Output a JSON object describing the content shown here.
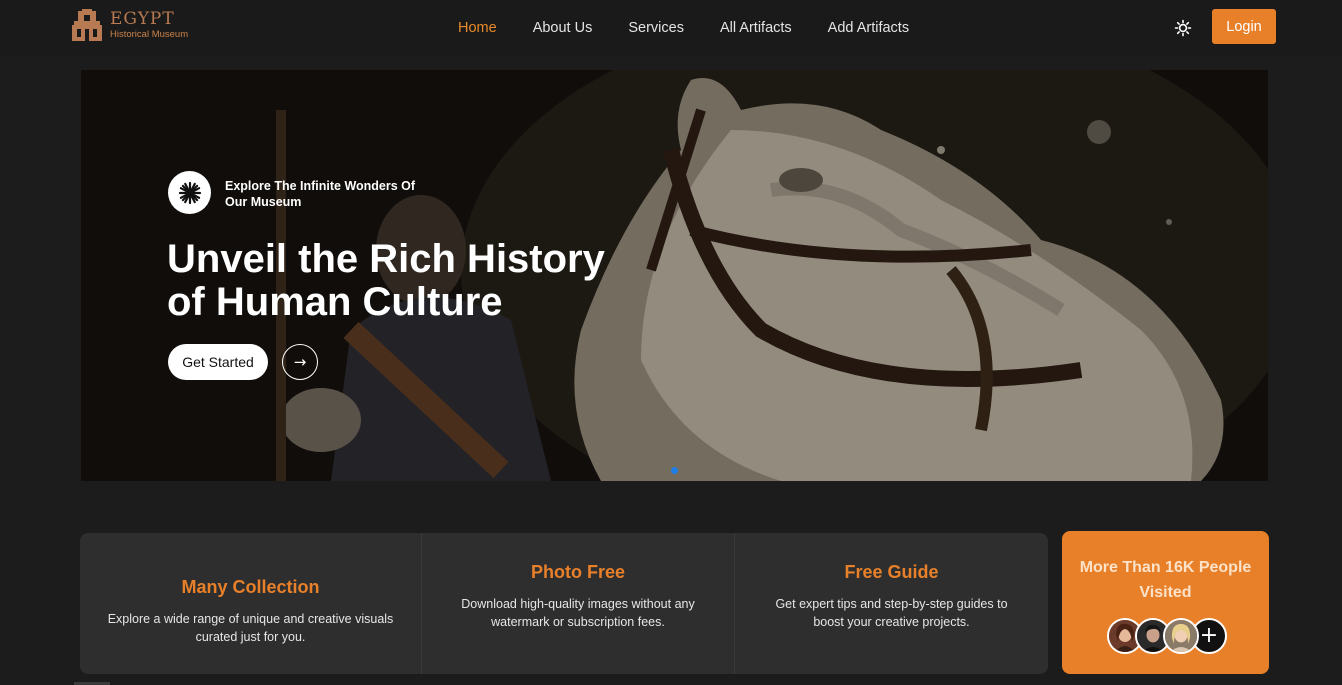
{
  "brand": {
    "title": "EGYPT",
    "subtitle": "Historical Museum"
  },
  "nav": {
    "items": [
      {
        "label": "Home",
        "active": true
      },
      {
        "label": "About Us",
        "active": false
      },
      {
        "label": "Services",
        "active": false
      },
      {
        "label": "All Artifacts",
        "active": false
      },
      {
        "label": "Add Artifacts",
        "active": false
      }
    ],
    "theme_toggle_icon": "sun-icon",
    "login_label": "Login"
  },
  "hero": {
    "badge_icon": "sunburst-icon",
    "subtitle": "Explore The Infinite Wonders Of Our Museum",
    "title_line1": "Unveil the Rich History",
    "title_line2": "of Human Culture",
    "cta_label": "Get Started",
    "arrow_icon": "arrow-right-icon",
    "arrow_glyph": "→",
    "active_slide": 1,
    "slide_count": 1
  },
  "features": [
    {
      "title": "Many Collection",
      "description": "Explore a wide range of unique and creative visuals curated just for you."
    },
    {
      "title": "Photo Free",
      "description": "Download high-quality images without any watermark or subscription fees."
    },
    {
      "title": "Free Guide",
      "description": "Get expert tips and step-by-step guides to boost your creative projects."
    }
  ],
  "visitors": {
    "text": "More Than 16K People Visited",
    "add_label": "+",
    "avatar_count": 3
  },
  "colors": {
    "accent": "#e8802a",
    "background": "#1c1c1c",
    "card": "#2e2e2e",
    "dot": "#1f7fe8"
  }
}
